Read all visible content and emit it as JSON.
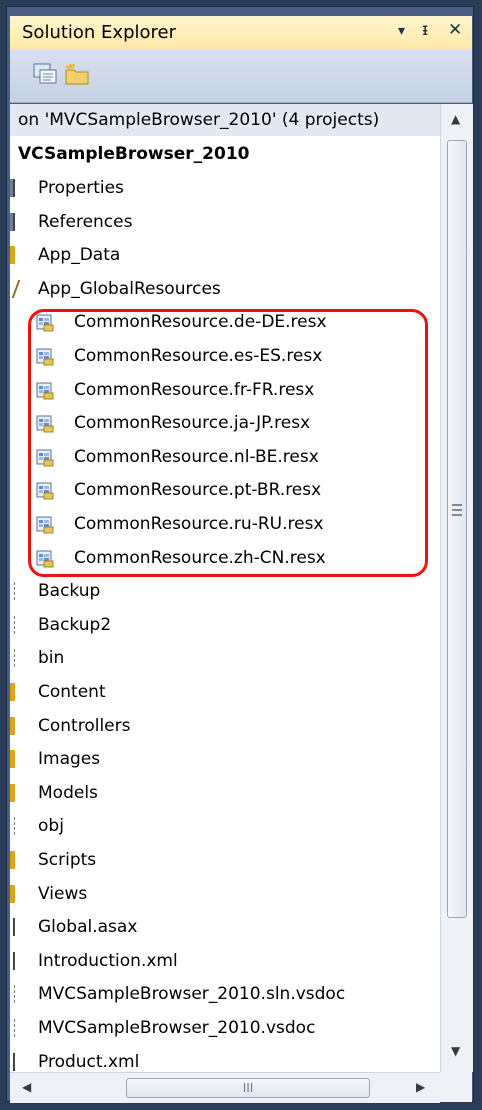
{
  "panel": {
    "title": "Solution Explorer",
    "pin_glyph": "▾",
    "autohide_glyph": "ᵻ",
    "close_glyph": "✕"
  },
  "toolbar": {
    "icons": [
      "properties-icon",
      "show-all-files-icon"
    ]
  },
  "tree": {
    "solution_label": "on 'MVCSampleBrowser_2010' (4 projects)",
    "project_label": "VCSampleBrowser_2010",
    "items": [
      {
        "label": "Properties",
        "icon": "properties-icon"
      },
      {
        "label": "References",
        "icon": "references-icon"
      },
      {
        "label": "App_Data",
        "icon": "folder-icon"
      },
      {
        "label": "App_GlobalResources",
        "icon": "folder-open-icon"
      },
      {
        "label": "CommonResource.de-DE.resx",
        "icon": "resource-file-icon"
      },
      {
        "label": "CommonResource.es-ES.resx",
        "icon": "resource-file-icon"
      },
      {
        "label": "CommonResource.fr-FR.resx",
        "icon": "resource-file-icon"
      },
      {
        "label": "CommonResource.ja-JP.resx",
        "icon": "resource-file-icon"
      },
      {
        "label": "CommonResource.nl-BE.resx",
        "icon": "resource-file-icon"
      },
      {
        "label": "CommonResource.pt-BR.resx",
        "icon": "resource-file-icon"
      },
      {
        "label": "CommonResource.ru-RU.resx",
        "icon": "resource-file-icon"
      },
      {
        "label": "CommonResource.zh-CN.resx",
        "icon": "resource-file-icon"
      },
      {
        "label": "Backup",
        "icon": "folder-dashed-icon"
      },
      {
        "label": "Backup2",
        "icon": "folder-dashed-icon"
      },
      {
        "label": "bin",
        "icon": "folder-dashed-icon"
      },
      {
        "label": "Content",
        "icon": "folder-icon"
      },
      {
        "label": "Controllers",
        "icon": "folder-icon"
      },
      {
        "label": "Images",
        "icon": "folder-icon"
      },
      {
        "label": "Models",
        "icon": "folder-icon"
      },
      {
        "label": "obj",
        "icon": "folder-dashed-icon"
      },
      {
        "label": "Scripts",
        "icon": "folder-icon"
      },
      {
        "label": "Views",
        "icon": "folder-icon"
      },
      {
        "label": "Global.asax",
        "icon": "file-icon"
      },
      {
        "label": "Introduction.xml",
        "icon": "file-icon"
      },
      {
        "label": "MVCSampleBrowser_2010.sln.vsdoc",
        "icon": "file-dashed-icon"
      },
      {
        "label": "MVCSampleBrowser_2010.vsdoc",
        "icon": "file-dashed-icon"
      },
      {
        "label": "Product.xml",
        "icon": "file-icon"
      }
    ]
  },
  "scrollbar": {
    "up": "▲",
    "down": "▼",
    "left": "◀",
    "right": "▶",
    "grip": "III"
  },
  "colors": {
    "highlight": "#ee1111",
    "title_bg": "#ffefbd",
    "folder": "#d9a521"
  }
}
